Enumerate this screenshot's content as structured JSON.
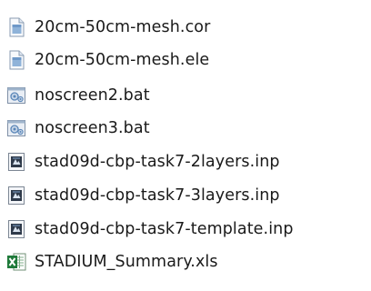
{
  "files": [
    {
      "name": "20cm-50cm-mesh.cor",
      "icon": "generic-file-icon"
    },
    {
      "name": "20cm-50cm-mesh.ele",
      "icon": "generic-file-icon"
    },
    {
      "name": "noscreen2.bat",
      "icon": "batch-file-icon"
    },
    {
      "name": "noscreen3.bat",
      "icon": "batch-file-icon"
    },
    {
      "name": "stad09d-cbp-task7-2layers.inp",
      "icon": "input-file-icon"
    },
    {
      "name": "stad09d-cbp-task7-3layers.inp",
      "icon": "input-file-icon"
    },
    {
      "name": "stad09d-cbp-task7-template.inp",
      "icon": "input-file-icon"
    },
    {
      "name": "STADIUM_Summary.xls",
      "icon": "excel-file-icon"
    }
  ],
  "colors": {
    "background": "#ffffff",
    "text": "#1a1a1a",
    "excel_green": "#1f7a3a",
    "batch_blue": "#5a86b8"
  }
}
